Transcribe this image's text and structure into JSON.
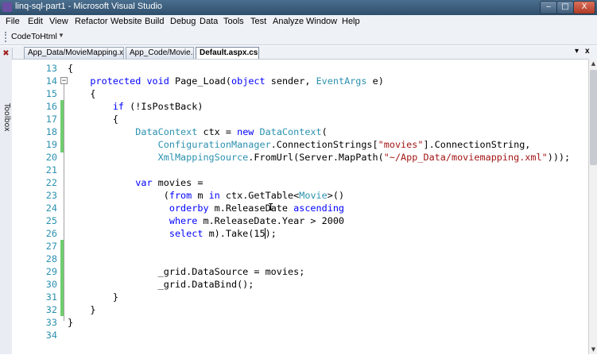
{
  "window": {
    "title": "linq-sql-part1 - Microsoft Visual Studio",
    "minimize": "‒",
    "maximize": "□",
    "close": "X"
  },
  "menu": [
    "File",
    "Edit",
    "View",
    "Refactor",
    "Website",
    "Build",
    "Debug",
    "Data",
    "Tools",
    "Test",
    "Analyze",
    "Window",
    "Help"
  ],
  "toolbar": {
    "button": "CodeToHtml",
    "dropdown": "▼"
  },
  "tabs": [
    {
      "label": "App_Data/MovieMapping.xml",
      "active": false
    },
    {
      "label": "App_Code/Movie.cs",
      "active": false
    },
    {
      "label": "Default.aspx.cs",
      "active": true
    }
  ],
  "tab_controls": {
    "dropdown": "▾",
    "close": "x"
  },
  "toolbox": {
    "label": "Toolbox"
  },
  "code_lines": [
    {
      "n": "13",
      "text": "{"
    },
    {
      "n": "14",
      "text": "    protected void Page_Load(object sender, EventArgs e)"
    },
    {
      "n": "15",
      "text": "    {"
    },
    {
      "n": "16",
      "text": "        if (!IsPostBack)"
    },
    {
      "n": "17",
      "text": "        {"
    },
    {
      "n": "18",
      "text": "            DataContext ctx = new DataContext("
    },
    {
      "n": "19",
      "text": "                ConfigurationManager.ConnectionStrings[\"movies\"].ConnectionString,"
    },
    {
      "n": "20",
      "text": "                XmlMappingSource.FromUrl(Server.MapPath(\"~/App_Data/moviemapping.xml\")));"
    },
    {
      "n": "21",
      "text": ""
    },
    {
      "n": "22",
      "text": "            var movies ="
    },
    {
      "n": "23",
      "text": "                 (from m in ctx.GetTable<Movie>()"
    },
    {
      "n": "24",
      "text": "                  orderby m.ReleaseDate ascending"
    },
    {
      "n": "25",
      "text": "                  where m.ReleaseDate.Year > 2000"
    },
    {
      "n": "26",
      "text": "                  select m).Take(15);"
    },
    {
      "n": "27",
      "text": ""
    },
    {
      "n": "28",
      "text": ""
    },
    {
      "n": "29",
      "text": "                _grid.DataSource = movies;"
    },
    {
      "n": "30",
      "text": "                _grid.DataBind();"
    },
    {
      "n": "31",
      "text": "        }"
    },
    {
      "n": "32",
      "text": "    }"
    },
    {
      "n": "33",
      "text": "}"
    },
    {
      "n": "34",
      "text": ""
    }
  ],
  "colors": {
    "keyword": "#0000ff",
    "type": "#2b91af",
    "string": "#a31515",
    "line_number": "#2b91af",
    "change_bar": "#6fce6f"
  }
}
